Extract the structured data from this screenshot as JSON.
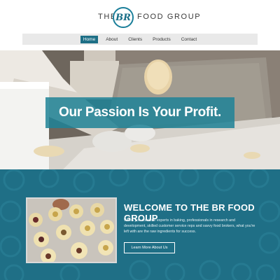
{
  "logo": {
    "left_text": "THE",
    "badge_text": "BR",
    "right_text": "FOOD GROUP"
  },
  "nav": {
    "items": [
      "Home",
      "About",
      "Clients",
      "Products",
      "Contact"
    ],
    "active": "Home"
  },
  "hero": {
    "tagline": "Our Passion Is Your Profit."
  },
  "about": {
    "title": "WELCOME TO THE BR FOOD GROUP",
    "text": "When you combine experts in baking, professionals in research and development, skilled customer service reps and savvy food brokers, what you're left with are the raw ingredients for success.",
    "button_label": "Learn More About Us"
  },
  "colors": {
    "accent": "#1e6f86",
    "banner": "#1e8296",
    "section_bg": "#1f6f86"
  }
}
